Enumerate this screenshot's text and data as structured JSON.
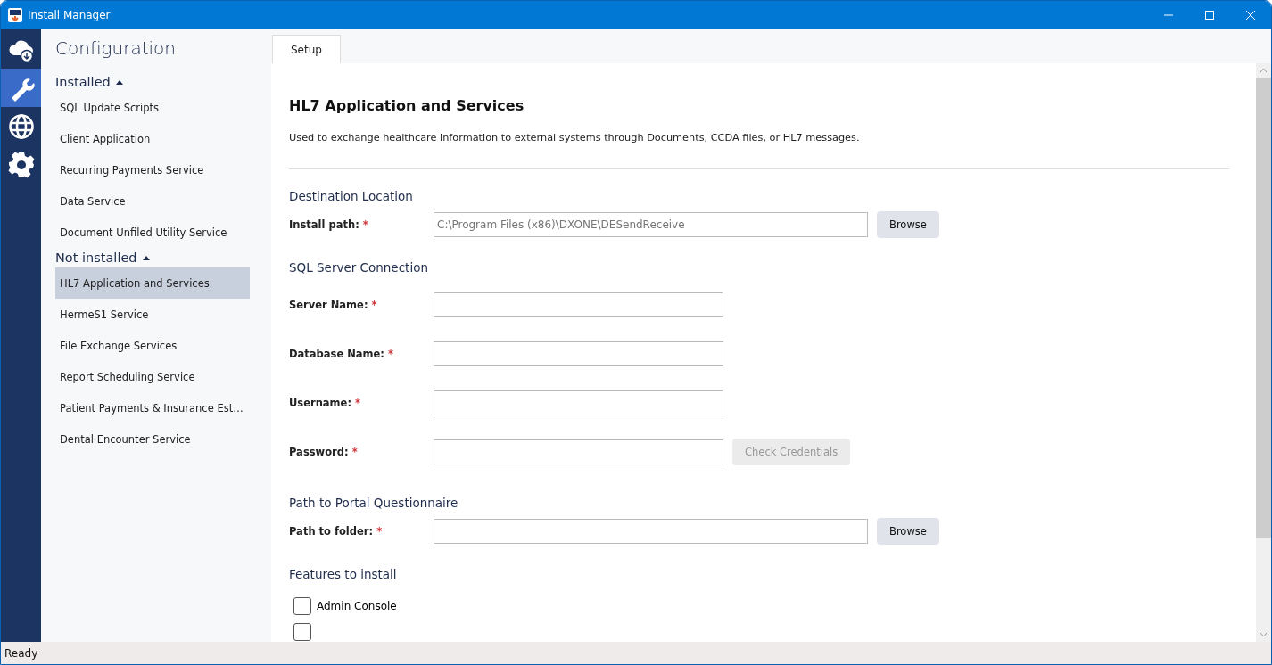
{
  "window": {
    "title": "Install Manager"
  },
  "rail": [
    {
      "selected": false
    },
    {
      "selected": true
    },
    {
      "selected": false
    },
    {
      "selected": false
    }
  ],
  "sidebar": {
    "title": "Configuration",
    "groups": [
      {
        "label": "Installed",
        "expanded": true,
        "items": [
          {
            "label": "SQL Update Scripts",
            "selected": false
          },
          {
            "label": "Client Application",
            "selected": false
          },
          {
            "label": "Recurring Payments Service",
            "selected": false
          },
          {
            "label": "Data Service",
            "selected": false
          },
          {
            "label": "Document Unfiled Utility Service",
            "selected": false
          }
        ]
      },
      {
        "label": "Not installed",
        "expanded": true,
        "items": [
          {
            "label": "HL7 Application and Services",
            "selected": true
          },
          {
            "label": "HermeS1 Service",
            "selected": false
          },
          {
            "label": "File Exchange Services",
            "selected": false
          },
          {
            "label": "Report Scheduling Service",
            "selected": false
          },
          {
            "label": "Patient Payments & Insurance Est…",
            "selected": false
          },
          {
            "label": "Dental Encounter Service",
            "selected": false
          }
        ]
      }
    ]
  },
  "tabs": [
    {
      "label": "Setup",
      "selected": true
    }
  ],
  "page": {
    "title": "HL7 Application and Services",
    "description": "Used to exchange healthcare information to external systems through Documents, CCDA files, or HL7 messages.",
    "sections": [
      {
        "title": "Destination Location",
        "fields": [
          {
            "label": "Install path:",
            "required": "*",
            "value": "C:\\Program Files (x86)\\DXONE\\DESendReceive",
            "kind": "wide",
            "button": {
              "label": "Browse",
              "disabled": false
            }
          }
        ]
      },
      {
        "title": "SQL Server Connection",
        "fields": [
          {
            "label": "Server Name:",
            "required": "*",
            "kind": "narrow"
          },
          {
            "label": "Database Name:",
            "required": "*",
            "kind": "narrow"
          },
          {
            "label": "Username:",
            "required": "*",
            "kind": "narrow"
          },
          {
            "label": "Password:",
            "required": "*",
            "kind": "narrow",
            "button": {
              "label": "Check Credentials",
              "disabled": true
            }
          }
        ]
      },
      {
        "title": "Path to Portal Questionnaire",
        "fields": [
          {
            "label": "Path to folder:",
            "required": "*",
            "kind": "wide",
            "button": {
              "label": "Browse",
              "disabled": false
            }
          }
        ]
      }
    ],
    "features": {
      "title": "Features to install",
      "items": [
        {
          "label": "Admin Console",
          "checked": false
        },
        {
          "checked": false
        }
      ]
    }
  },
  "status_bar": {
    "text": "Ready"
  }
}
